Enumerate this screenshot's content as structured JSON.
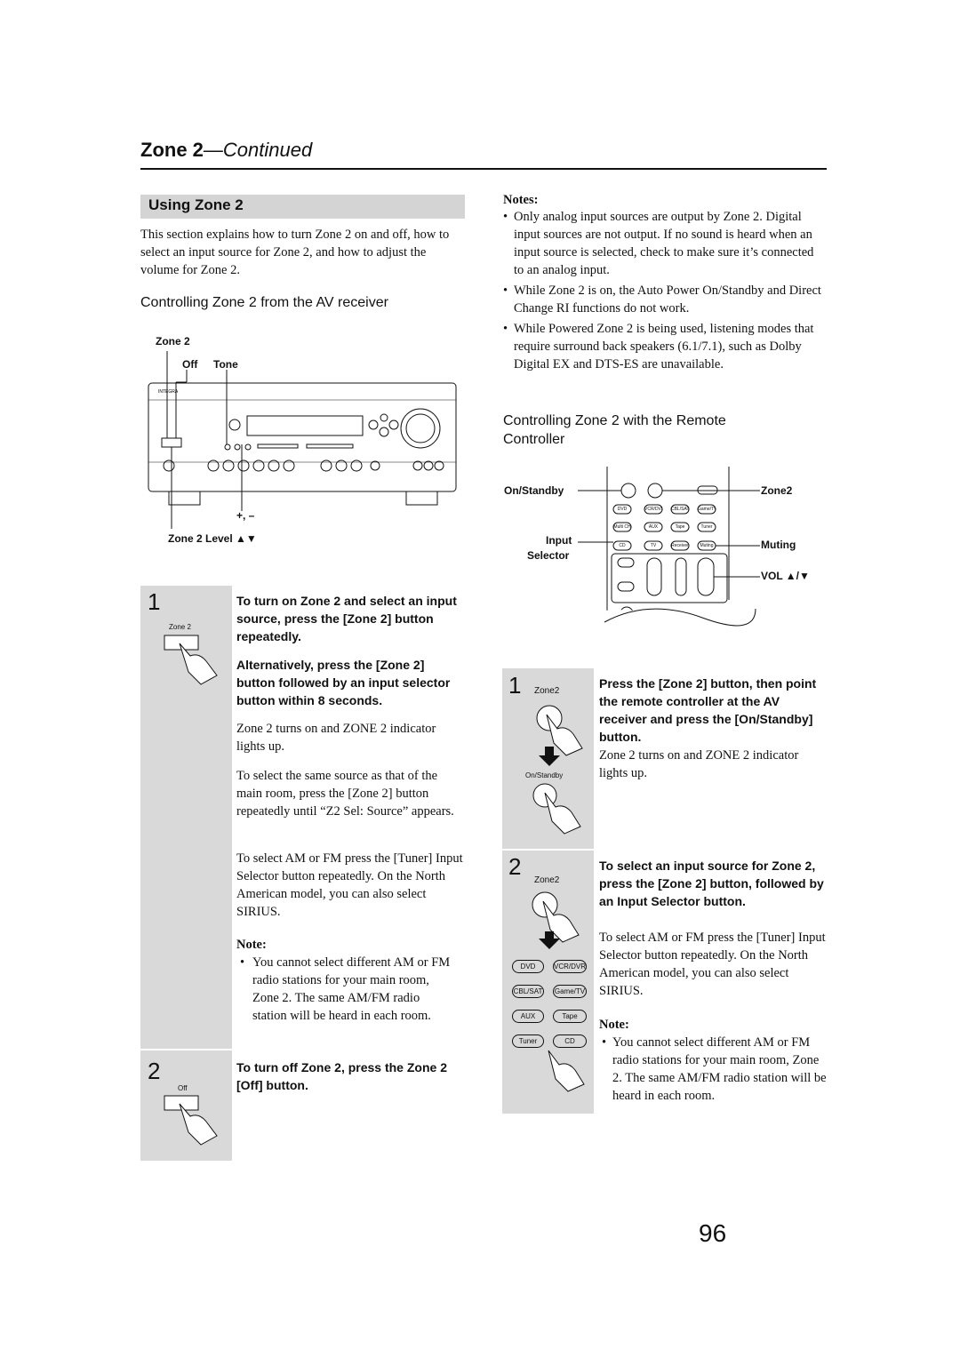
{
  "header": {
    "title": "Zone 2",
    "continued": "—Continued"
  },
  "section": {
    "title": "Using Zone 2",
    "intro": "This section explains how to turn Zone 2 on and off, how to select an input source for Zone 2, and how to adjust the volume for Zone 2."
  },
  "receiver": {
    "heading": "Controlling Zone 2 from the AV receiver",
    "labels": {
      "zone2": "Zone 2",
      "off": "Off",
      "tone": "Tone",
      "plusminus": "+, –",
      "level": "Zone 2 Level ▲▼"
    }
  },
  "left_steps": [
    {
      "number": "1",
      "icon_label": "Zone 2",
      "bold1": "To turn on Zone 2 and select an input source, press the [Zone 2] button repeatedly.",
      "bold2": "Alternatively, press the [Zone 2] button followed by an input selector button within 8 seconds.",
      "p1": "Zone 2 turns on and ZONE 2 indicator lights up.",
      "p2": "To select the same source as that of the main room, press the [Zone 2] button repeatedly until “Z2 Sel: Source” appears.",
      "p3": "To select AM or FM press the [Tuner] Input Selector button repeatedly. On the North American model, you can also select SIRIUS.",
      "note_title": "Note:",
      "note": "You cannot select different AM or FM radio stations for your main room, Zone 2. The same AM/FM radio station will be heard in each room."
    },
    {
      "number": "2",
      "icon_label": "Off",
      "bold1": "To turn off Zone 2, press the Zone 2 [Off] button."
    }
  ],
  "notes": {
    "title": "Notes:",
    "items": [
      "Only analog input sources are output by Zone 2. Digital input sources are not output. If no sound is heard when an input source is selected, check to make sure it’s connected to an analog input.",
      "While Zone 2 is on, the Auto Power On/Standby and Direct Change RI functions do not work.",
      "While Powered Zone 2 is being used, listening modes that require surround back speakers (6.1/7.1), such as Dolby Digital EX and DTS-ES are unavailable."
    ]
  },
  "remote": {
    "heading": "Controlling Zone 2 with the Remote Controller",
    "labels": {
      "onstandby": "On/Standby",
      "input": "Input",
      "selector": "Selector",
      "zone2": "Zone2",
      "muting": "Muting",
      "vol": "VOL ▲/▼"
    },
    "buttons": [
      "DVD",
      "VCR/DVR",
      "CBL/SAT",
      "Game/TV",
      "Multi CH",
      "AUX",
      "Tape",
      "Tuner",
      "CD",
      "TV",
      "Receiver",
      "Muting"
    ]
  },
  "right_steps": [
    {
      "number": "1",
      "icon_label": "Zone2",
      "icon_label2": "On/Standby",
      "bold": "Press the [Zone 2] button, then point the remote controller at the AV receiver and press the [On/Standby] button.",
      "p1": "Zone 2 turns on and ZONE 2 indicator lights up."
    },
    {
      "number": "2",
      "icon_label": "Zone2",
      "buttons": [
        "DVD",
        "VCR/DVR",
        "CBL/SAT",
        "Game/TV",
        "AUX",
        "Tape",
        "Tuner",
        "CD"
      ],
      "bold": "To select an input source for Zone 2, press the [Zone 2] button, followed by an Input Selector button.",
      "p1": "To select AM or FM press the [Tuner] Input Selector button repeatedly. On the North American model, you can also select SIRIUS.",
      "note_title": "Note:",
      "note": "You cannot select different AM or FM radio stations for your main room, Zone 2. The same AM/FM radio station will be heard in each room."
    }
  ],
  "page_number": "96"
}
